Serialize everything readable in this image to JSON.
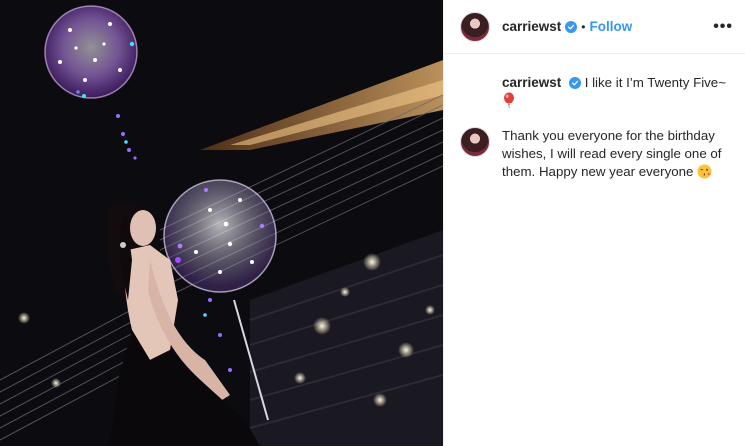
{
  "post": {
    "author": "carriewst",
    "follow_label": "Follow",
    "separator": "•",
    "more_label": "•••"
  },
  "caption": {
    "author": "carriewst",
    "text": "I like it I’m Twenty Five~",
    "emoji": "balloon"
  },
  "comments": [
    {
      "text": "Thank you everyone for the birthday wishes, I will read every single one of them. Happy new year everyone",
      "emoji": "winking-kiss-face"
    }
  ],
  "colors": {
    "accent": "#3897f0",
    "text": "#262626",
    "divider": "#efefef"
  }
}
